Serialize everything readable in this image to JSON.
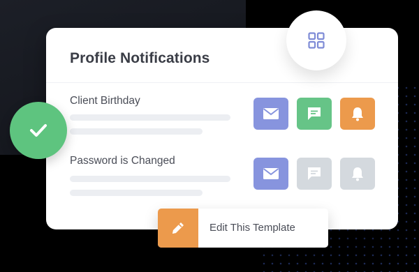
{
  "card": {
    "title": "Profile Notifications"
  },
  "rows": [
    {
      "label": "Client Birthday",
      "channels": [
        {
          "icon": "mail-icon",
          "enabled": true,
          "color": "#8794de"
        },
        {
          "icon": "chat-icon",
          "enabled": true,
          "color": "#66c487"
        },
        {
          "icon": "bell-icon",
          "enabled": true,
          "color": "#ec9a4c"
        }
      ]
    },
    {
      "label": "Password is Changed",
      "channels": [
        {
          "icon": "mail-icon",
          "enabled": true,
          "color": "#8794de"
        },
        {
          "icon": "chat-icon",
          "enabled": false,
          "color": "#d4d9de"
        },
        {
          "icon": "bell-icon",
          "enabled": false,
          "color": "#d4d9de"
        }
      ]
    }
  ],
  "edit_template": {
    "label": "Edit This Template",
    "color": "#ec9a4c"
  },
  "colors": {
    "check_green": "#5ec47f",
    "grid_icon": "#7e8bd6"
  }
}
